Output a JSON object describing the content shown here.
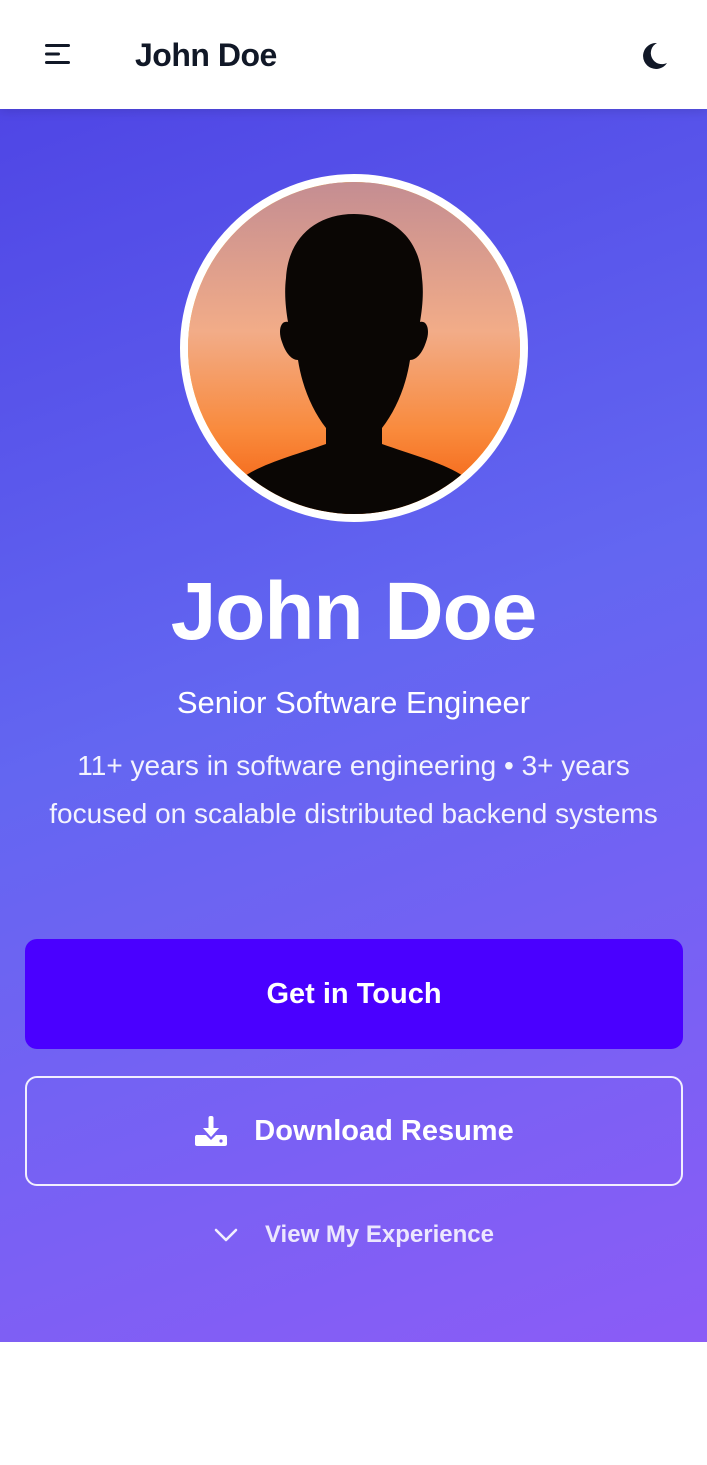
{
  "header": {
    "brand": "John Doe",
    "menu_icon": "menu-icon",
    "theme_icon": "moon-icon"
  },
  "hero": {
    "name": "John Doe",
    "role": "Senior Software Engineer",
    "summary": "11+ years in software engineering • 3+ years focused on scalable distributed backend systems",
    "primary_button": "Get in Touch",
    "secondary_button": "Download Resume",
    "secondary_icon": "download-icon",
    "scroll_link": "View My Experience",
    "scroll_icon": "chevron-down-icon"
  },
  "colors": {
    "hero_gradient_start": "#4f46e5",
    "hero_gradient_end": "#8b5cf6",
    "primary_button": "#4a00ff",
    "brand_text": "#111827"
  }
}
